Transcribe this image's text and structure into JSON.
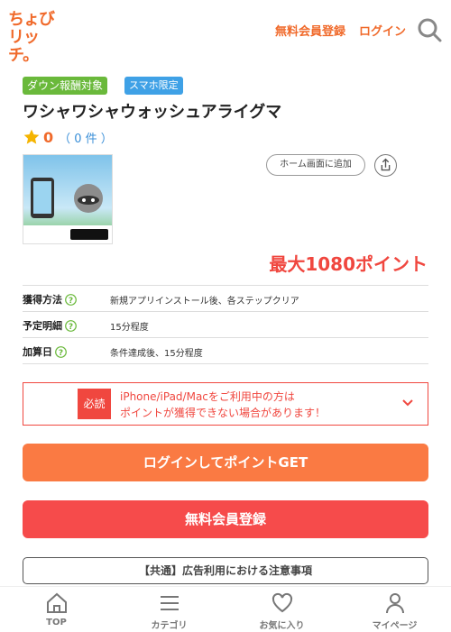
{
  "header": {
    "logo_line1": "ちょび",
    "logo_line2": "リッチ。",
    "register_link": "無料会員登録",
    "login_link": "ログイン"
  },
  "tags": [
    "ダウン報酬対象",
    "スマホ限定"
  ],
  "ad": {
    "title": "ワシャワシャウォッシュアライグマ",
    "rating": "0",
    "review_count": "（ 0 件 ）",
    "home_button": "ホーム画面に追加",
    "max_points": "最大1080ポイント"
  },
  "info_rows": [
    {
      "label": "獲得方法",
      "value": "新規アプリインストール後、各ステップクリア"
    },
    {
      "label": "予定明細",
      "value": "15分程度"
    },
    {
      "label": "加算日",
      "value": "条件達成後、15分程度"
    }
  ],
  "notice": {
    "badge": "必読",
    "line1": "iPhone/iPad/Macをご利用中の方は",
    "line2": "ポイントが獲得できない場合があります！"
  },
  "buttons": {
    "login": "ログインしてポイントGET",
    "register": "無料会員登録",
    "caution": "【共通】広告利用における注意事項"
  },
  "bottom_nav": [
    {
      "label": "TOP",
      "icon": "home-icon"
    },
    {
      "label": "カテゴリ",
      "icon": "menu-icon"
    },
    {
      "label": "お気に入り",
      "icon": "heart-icon"
    },
    {
      "label": "マイページ",
      "icon": "person-icon"
    }
  ],
  "colors": {
    "brand": "#f06a2b",
    "accent_red": "#f0473f",
    "login_button": "#fa7a43",
    "register_button": "#f64b4b"
  }
}
